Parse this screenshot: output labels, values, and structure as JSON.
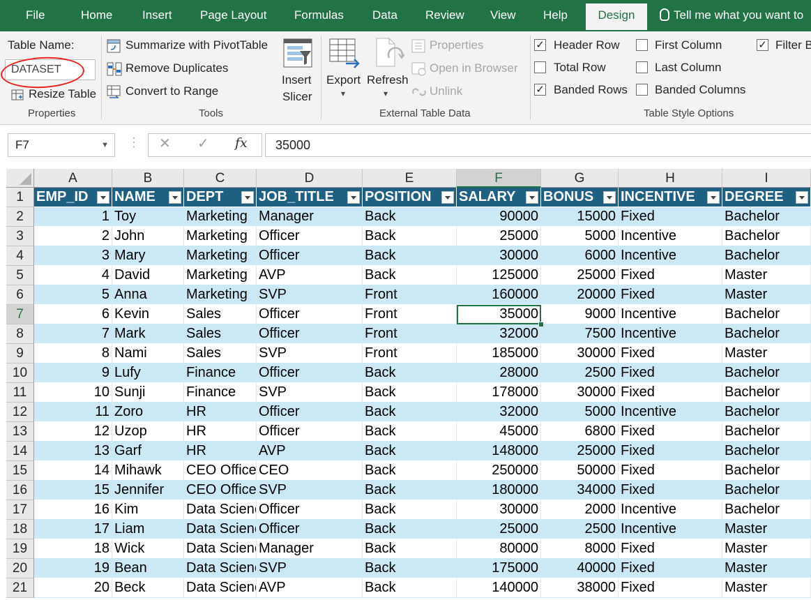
{
  "ribbon_tabs": [
    {
      "label": "File"
    },
    {
      "label": "Home"
    },
    {
      "label": "Insert"
    },
    {
      "label": "Page Layout"
    },
    {
      "label": "Formulas"
    },
    {
      "label": "Data"
    },
    {
      "label": "Review"
    },
    {
      "label": "View"
    },
    {
      "label": "Help"
    },
    {
      "label": "Design"
    }
  ],
  "tell_me": "Tell me what you want to",
  "properties": {
    "table_name_label": "Table Name:",
    "table_name_value": "DATASET",
    "resize": "Resize Table",
    "group": "Properties"
  },
  "tools": {
    "summarize": "Summarize with PivotTable",
    "remove_dup": "Remove Duplicates",
    "convert": "Convert to Range",
    "insert_slicer_1": "Insert",
    "insert_slicer_2": "Slicer",
    "group": "Tools"
  },
  "external": {
    "export": "Export",
    "refresh": "Refresh",
    "properties": "Properties",
    "open_browser": "Open in Browser",
    "unlink": "Unlink",
    "group": "External Table Data"
  },
  "style_options": {
    "header_row": "Header Row",
    "total_row": "Total Row",
    "banded_rows": "Banded Rows",
    "first_column": "First Column",
    "last_column": "Last Column",
    "banded_columns": "Banded Columns",
    "filter_button": "Filter B",
    "checked": {
      "header_row": true,
      "total_row": false,
      "banded_rows": true,
      "first_column": false,
      "last_column": false,
      "banded_columns": false,
      "filter_button": true
    },
    "group": "Table Style Options"
  },
  "formula_bar": {
    "name_box": "F7",
    "fx": "fx",
    "value": "35000"
  },
  "columns": [
    "A",
    "B",
    "C",
    "D",
    "E",
    "F",
    "G",
    "H",
    "I"
  ],
  "headers": [
    "EMP_ID",
    "NAME",
    "DEPT",
    "JOB_TITLE",
    "POSITION",
    "SALARY",
    "BONUS",
    "INCENTIVE",
    "DEGREE"
  ],
  "rows": [
    [
      "1",
      "Toy",
      "Marketing",
      "Manager",
      "Back",
      "90000",
      "15000",
      "Fixed",
      "Bachelor"
    ],
    [
      "2",
      "John",
      "Marketing",
      "Officer",
      "Back",
      "25000",
      "5000",
      "Incentive",
      "Bachelor"
    ],
    [
      "3",
      "Mary",
      "Marketing",
      "Officer",
      "Back",
      "30000",
      "6000",
      "Incentive",
      "Bachelor"
    ],
    [
      "4",
      "David",
      "Marketing",
      "AVP",
      "Back",
      "125000",
      "25000",
      "Fixed",
      "Master"
    ],
    [
      "5",
      "Anna",
      "Marketing",
      "SVP",
      "Front",
      "160000",
      "20000",
      "Fixed",
      "Master"
    ],
    [
      "6",
      "Kevin",
      "Sales",
      "Officer",
      "Front",
      "35000",
      "9000",
      "Incentive",
      "Bachelor"
    ],
    [
      "7",
      "Mark",
      "Sales",
      "Officer",
      "Front",
      "32000",
      "7500",
      "Incentive",
      "Bachelor"
    ],
    [
      "8",
      "Nami",
      "Sales",
      "SVP",
      "Front",
      "185000",
      "30000",
      "Fixed",
      "Master"
    ],
    [
      "9",
      "Lufy",
      "Finance",
      "Officer",
      "Back",
      "28000",
      "2500",
      "Fixed",
      "Bachelor"
    ],
    [
      "10",
      "Sunji",
      "Finance",
      "SVP",
      "Back",
      "178000",
      "30000",
      "Fixed",
      "Bachelor"
    ],
    [
      "11",
      "Zoro",
      "HR",
      "Officer",
      "Back",
      "32000",
      "5000",
      "Incentive",
      "Bachelor"
    ],
    [
      "12",
      "Uzop",
      "HR",
      "Officer",
      "Back",
      "45000",
      "6800",
      "Fixed",
      "Bachelor"
    ],
    [
      "13",
      "Garf",
      "HR",
      "AVP",
      "Back",
      "148000",
      "25000",
      "Fixed",
      "Bachelor"
    ],
    [
      "14",
      "Mihawk",
      "CEO Office",
      "CEO",
      "Back",
      "250000",
      "50000",
      "Fixed",
      "Bachelor"
    ],
    [
      "15",
      "Jennifer",
      "CEO Office",
      "SVP",
      "Back",
      "180000",
      "34000",
      "Fixed",
      "Bachelor"
    ],
    [
      "16",
      "Kim",
      "Data Science",
      "Officer",
      "Back",
      "30000",
      "2000",
      "Incentive",
      "Bachelor"
    ],
    [
      "17",
      "Liam",
      "Data Science",
      "Officer",
      "Back",
      "25000",
      "2500",
      "Incentive",
      "Master"
    ],
    [
      "18",
      "Wick",
      "Data Science",
      "Manager",
      "Back",
      "80000",
      "8000",
      "Fixed",
      "Master"
    ],
    [
      "19",
      "Bean",
      "Data Science",
      "SVP",
      "Back",
      "175000",
      "40000",
      "Fixed",
      "Master"
    ],
    [
      "20",
      "Beck",
      "Data Science",
      "AVP",
      "Back",
      "140000",
      "38000",
      "Fixed",
      "Master"
    ]
  ]
}
